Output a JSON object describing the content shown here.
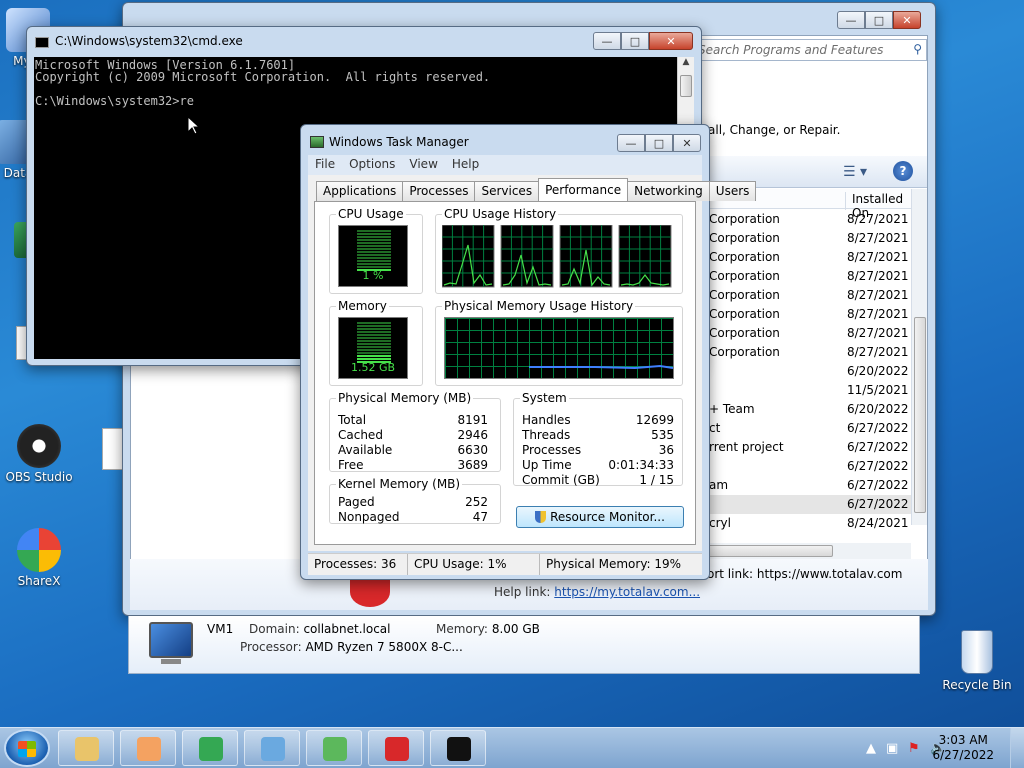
{
  "desktop": {
    "icons": [
      {
        "label": "My C",
        "name": "my-computer"
      },
      {
        "label": "Data",
        "name": "data"
      },
      {
        "label": "OBS Studio",
        "name": "obs-studio"
      },
      {
        "label": "ShareX",
        "name": "sharex"
      }
    ],
    "recycle_bin": "Recycle Bin"
  },
  "programs_features": {
    "search_placeholder": "Search Programs and Features",
    "header_text": "all, Change, or Repair.",
    "column_installed_on": "Installed On",
    "rows": [
      {
        "publisher": "Corporation",
        "date": "8/27/2021"
      },
      {
        "publisher": "Corporation",
        "date": "8/27/2021"
      },
      {
        "publisher": "Corporation",
        "date": "8/27/2021"
      },
      {
        "publisher": "Corporation",
        "date": "8/27/2021"
      },
      {
        "publisher": "Corporation",
        "date": "8/27/2021"
      },
      {
        "publisher": "Corporation",
        "date": "8/27/2021"
      },
      {
        "publisher": "Corporation",
        "date": "8/27/2021"
      },
      {
        "publisher": "Corporation",
        "date": "8/27/2021"
      },
      {
        "publisher": "",
        "date": "6/20/2022"
      },
      {
        "publisher": "",
        "date": "11/5/2021"
      },
      {
        "publisher": "+ Team",
        "date": "6/20/2022"
      },
      {
        "publisher": "ct",
        "date": "6/27/2022"
      },
      {
        "publisher": "rrent project",
        "date": "6/27/2022"
      },
      {
        "publisher": "",
        "date": "6/27/2022"
      },
      {
        "publisher": "am",
        "date": "6/27/2022"
      },
      {
        "publisher": "",
        "date": "6/27/2022"
      },
      {
        "publisher": "cryl",
        "date": "8/24/2021"
      }
    ],
    "support_link_label": "ort link:",
    "support_link": "https://www.totalav.com",
    "help_link_label": "Help link:",
    "help_link": "https://my.totalav.com..."
  },
  "computer_bar": {
    "name": "VM1",
    "domain_label": "Domain:",
    "domain": "collabnet.local",
    "memory_label": "Memory:",
    "memory": "8.00 GB",
    "processor_label": "Processor:",
    "processor": "AMD Ryzen 7 5800X 8-C..."
  },
  "cmd": {
    "title": "C:\\Windows\\system32\\cmd.exe",
    "lines": [
      "Microsoft Windows [Version 6.1.7601]",
      "Copyright (c) 2009 Microsoft Corporation.  All rights reserved.",
      "",
      "C:\\Windows\\system32>re"
    ]
  },
  "task_manager": {
    "title": "Windows Task Manager",
    "menu": [
      "File",
      "Options",
      "View",
      "Help"
    ],
    "tabs": [
      "Applications",
      "Processes",
      "Services",
      "Performance",
      "Networking",
      "Users"
    ],
    "active_tab": "Performance",
    "cpu_usage_label": "CPU Usage",
    "cpu_usage_value": "1 %",
    "cpu_usage_fraction": 0.01,
    "cpu_history_label": "CPU Usage History",
    "memory_label": "Memory",
    "memory_value": "1.52 GB",
    "memory_fraction": 0.19,
    "phys_history_label": "Physical Memory Usage History",
    "physical_memory": {
      "title": "Physical Memory (MB)",
      "rows": [
        {
          "k": "Total",
          "v": "8191"
        },
        {
          "k": "Cached",
          "v": "2946"
        },
        {
          "k": "Available",
          "v": "6630"
        },
        {
          "k": "Free",
          "v": "3689"
        }
      ]
    },
    "kernel_memory": {
      "title": "Kernel Memory (MB)",
      "rows": [
        {
          "k": "Paged",
          "v": "252"
        },
        {
          "k": "Nonpaged",
          "v": "47"
        }
      ]
    },
    "system": {
      "title": "System",
      "rows": [
        {
          "k": "Handles",
          "v": "12699"
        },
        {
          "k": "Threads",
          "v": "535"
        },
        {
          "k": "Processes",
          "v": "36"
        },
        {
          "k": "Up Time",
          "v": "0:01:34:33"
        },
        {
          "k": "Commit (GB)",
          "v": "1 / 15"
        }
      ]
    },
    "resource_monitor_button": "Resource Monitor...",
    "status": {
      "processes": "Processes: 36",
      "cpu": "CPU Usage: 1%",
      "memory": "Physical Memory: 19%"
    }
  },
  "taskbar": {
    "clock_time": "3:03 AM",
    "clock_date": "6/27/2022",
    "apps": [
      {
        "name": "explorer",
        "color": "#e9c46a"
      },
      {
        "name": "media-player",
        "color": "#f4a261"
      },
      {
        "name": "chrome",
        "color": "#34a853"
      },
      {
        "name": "control-panel",
        "color": "#6aa9e0"
      },
      {
        "name": "task-manager",
        "color": "#5cb85c"
      },
      {
        "name": "totalav",
        "color": "#d8282a"
      },
      {
        "name": "cmd",
        "color": "#111111"
      }
    ]
  }
}
